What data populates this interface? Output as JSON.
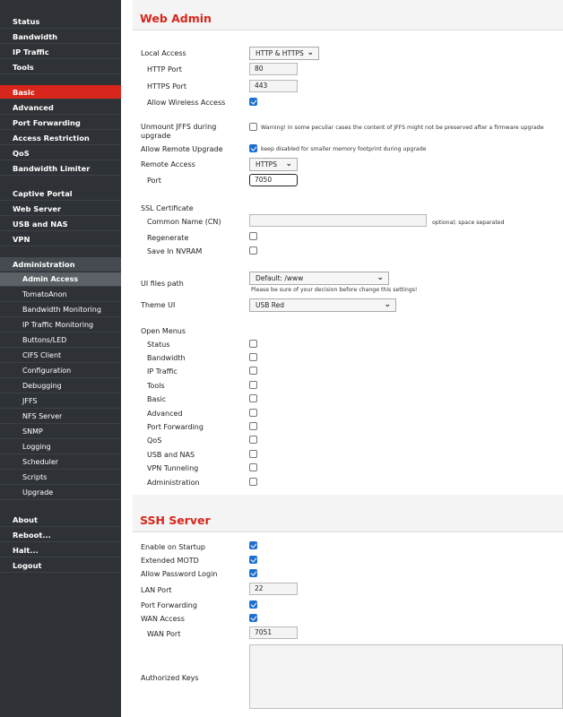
{
  "sidebar": {
    "items": [
      {
        "label": "Status",
        "kind": "top"
      },
      {
        "label": "Bandwidth",
        "kind": "top"
      },
      {
        "label": "IP Traffic",
        "kind": "top"
      },
      {
        "label": "Tools",
        "kind": "top"
      },
      {
        "label": "Basic",
        "kind": "active"
      },
      {
        "label": "Advanced",
        "kind": "top"
      },
      {
        "label": "Port Forwarding",
        "kind": "top"
      },
      {
        "label": "Access Restriction",
        "kind": "top"
      },
      {
        "label": "QoS",
        "kind": "top"
      },
      {
        "label": "Bandwidth Limiter",
        "kind": "top"
      },
      {
        "label": "Captive Portal",
        "kind": "top"
      },
      {
        "label": "Web Server",
        "kind": "top"
      },
      {
        "label": "USB and NAS",
        "kind": "top"
      },
      {
        "label": "VPN",
        "kind": "top"
      },
      {
        "label": "Administration",
        "kind": "section"
      },
      {
        "label": "Admin Access",
        "kind": "selected"
      },
      {
        "label": "TomatoAnon",
        "kind": "sub"
      },
      {
        "label": "Bandwidth Monitoring",
        "kind": "sub"
      },
      {
        "label": "IP Traffic Monitoring",
        "kind": "sub"
      },
      {
        "label": "Buttons/LED",
        "kind": "sub"
      },
      {
        "label": "CIFS Client",
        "kind": "sub"
      },
      {
        "label": "Configuration",
        "kind": "sub"
      },
      {
        "label": "Debugging",
        "kind": "sub"
      },
      {
        "label": "JFFS",
        "kind": "sub"
      },
      {
        "label": "NFS Server",
        "kind": "sub"
      },
      {
        "label": "SNMP",
        "kind": "sub"
      },
      {
        "label": "Logging",
        "kind": "sub"
      },
      {
        "label": "Scheduler",
        "kind": "sub"
      },
      {
        "label": "Scripts",
        "kind": "sub"
      },
      {
        "label": "Upgrade",
        "kind": "sub"
      },
      {
        "label": "About",
        "kind": "top"
      },
      {
        "label": "Reboot...",
        "kind": "top"
      },
      {
        "label": "Halt...",
        "kind": "top"
      },
      {
        "label": "Logout",
        "kind": "top"
      }
    ]
  },
  "web_admin": {
    "title": "Web Admin",
    "local_access": {
      "label": "Local Access",
      "value": "HTTP & HTTPS"
    },
    "http_port": {
      "label": "HTTP Port",
      "value": "80"
    },
    "https_port": {
      "label": "HTTPS Port",
      "value": "443"
    },
    "allow_wireless": {
      "label": "Allow Wireless Access",
      "checked": true
    },
    "unmount_jffs": {
      "label": "Unmount JFFS during upgrade",
      "checked": false,
      "note": "Warning! In some peculiar cases the content of JFFS might not be preserved after a firmware upgrade"
    },
    "allow_remote_upgrade": {
      "label": "Allow Remote Upgrade",
      "checked": true,
      "note": "keep disabled for smaller memory footprint during upgrade"
    },
    "remote_access": {
      "label": "Remote Access",
      "value": "HTTPS"
    },
    "port": {
      "label": "Port",
      "value": "7050"
    },
    "ssl_certificate": {
      "label": "SSL Certificate"
    },
    "common_name": {
      "label": "Common Name (CN)",
      "value": "",
      "note": "optional; space separated"
    },
    "regenerate": {
      "label": "Regenerate",
      "checked": false
    },
    "save_nvram": {
      "label": "Save In NVRAM",
      "checked": false
    },
    "ui_files_path": {
      "label": "UI files path",
      "value": "Default: /www",
      "note": "Please be sure of your decision before change this settings!"
    },
    "theme_ui": {
      "label": "Theme UI",
      "value": "USB Red"
    },
    "open_menus": {
      "label": "Open Menus",
      "items": [
        {
          "label": "Status",
          "checked": false
        },
        {
          "label": "Bandwidth",
          "checked": false
        },
        {
          "label": "IP Traffic",
          "checked": false
        },
        {
          "label": "Tools",
          "checked": false
        },
        {
          "label": "Basic",
          "checked": false
        },
        {
          "label": "Advanced",
          "checked": false
        },
        {
          "label": "Port Forwarding",
          "checked": false
        },
        {
          "label": "QoS",
          "checked": false
        },
        {
          "label": "USB and NAS",
          "checked": false
        },
        {
          "label": "VPN Tunneling",
          "checked": false
        },
        {
          "label": "Administration",
          "checked": false
        }
      ]
    }
  },
  "ssh_server": {
    "title": "SSH Server",
    "enable_on_startup": {
      "label": "Enable on Startup",
      "checked": true
    },
    "extended_motd": {
      "label": "Extended MOTD",
      "checked": true
    },
    "allow_password_login": {
      "label": "Allow Password Login",
      "checked": true
    },
    "lan_port": {
      "label": "LAN Port",
      "value": "22"
    },
    "port_forwarding": {
      "label": "Port Forwarding",
      "checked": true
    },
    "wan_access": {
      "label": "WAN Access",
      "checked": true
    },
    "wan_port": {
      "label": "WAN Port",
      "value": "7051"
    },
    "authorized_keys": {
      "label": "Authorized Keys",
      "value": ""
    }
  },
  "colors": {
    "accent": "#d8261c",
    "sidebar": "#2e3236",
    "checkbox": "#1f6fcf"
  },
  "icons": {
    "dropdown": "chevron-down-icon",
    "checkbox": "check-icon"
  }
}
